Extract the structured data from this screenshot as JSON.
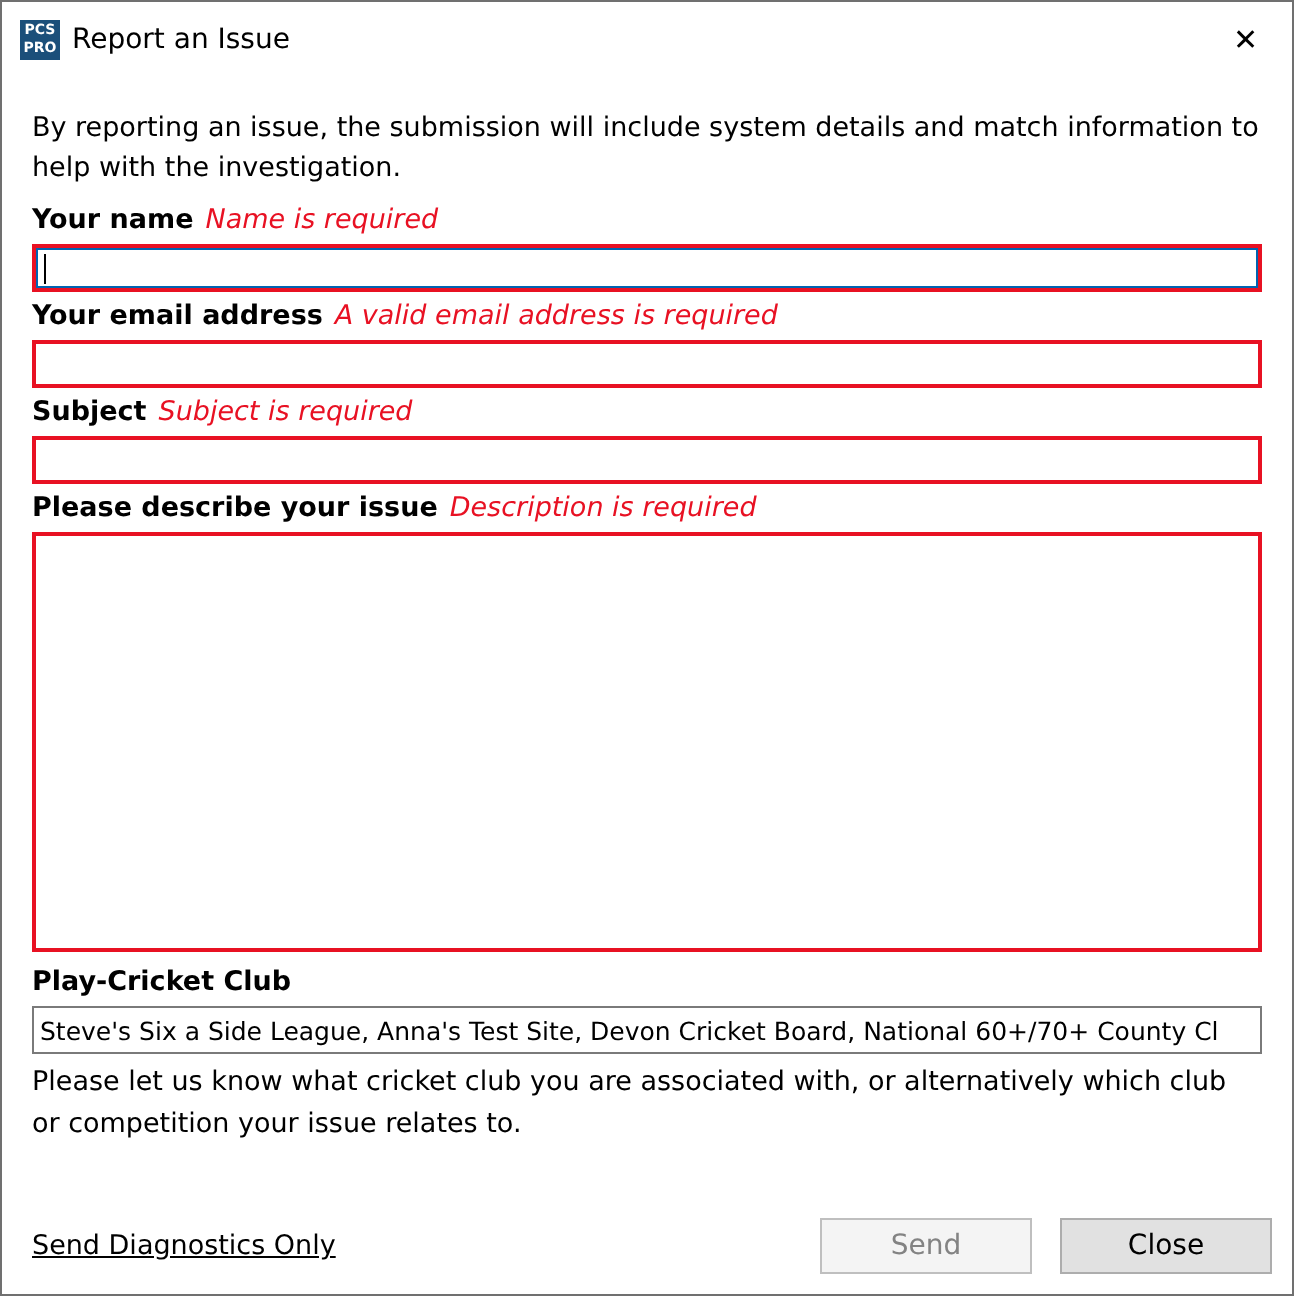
{
  "window": {
    "title": "Report an Issue",
    "logo_top": "PCS",
    "logo_bottom": "PRO",
    "close": "✕"
  },
  "intro": "By reporting an issue, the submission will include system details and match information to help with the investigation.",
  "fields": [
    {
      "kind": "text",
      "label": "Your name",
      "error": "Name is required",
      "focused": true
    },
    {
      "kind": "text",
      "label": "Your email address",
      "error": "A valid email address is required",
      "focused": false
    },
    {
      "kind": "text",
      "label": "Subject",
      "error": "Subject is required",
      "focused": false
    },
    {
      "kind": "textarea",
      "label": "Please describe your issue",
      "error": "Description is required",
      "focused": false
    }
  ],
  "club": {
    "label": "Play-Cricket Club",
    "value": "Steve's Six a Side League, Anna's Test Site, Devon Cricket Board, National 60+/70+ County Cl",
    "help": "Please let us know what cricket club you are associated with, or alternatively which club or competition your issue relates to."
  },
  "diagnostics_link": "Send Diagnostics Only",
  "buttons": [
    {
      "label": "Send",
      "disabled": true
    },
    {
      "label": "Close",
      "disabled": false
    }
  ]
}
